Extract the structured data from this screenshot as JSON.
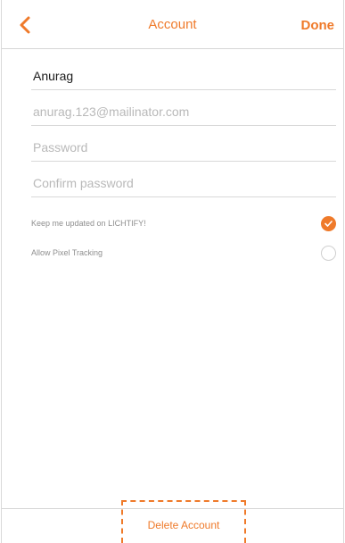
{
  "nav": {
    "title": "Account",
    "done_label": "Done"
  },
  "form": {
    "name_value": "Anurag",
    "email_value": "anurag.123@mailinator.com",
    "password_placeholder": "Password",
    "confirm_password_placeholder": "Confirm password"
  },
  "options": [
    {
      "label": "Keep me updated on LICHTIFY!",
      "checked": true
    },
    {
      "label": "Allow Pixel Tracking",
      "checked": false
    }
  ],
  "footer": {
    "delete_label": "Delete Account"
  },
  "colors": {
    "accent": "#ef7a2a",
    "divider": "#d6d6d6",
    "placeholder": "#b9b9b9"
  }
}
